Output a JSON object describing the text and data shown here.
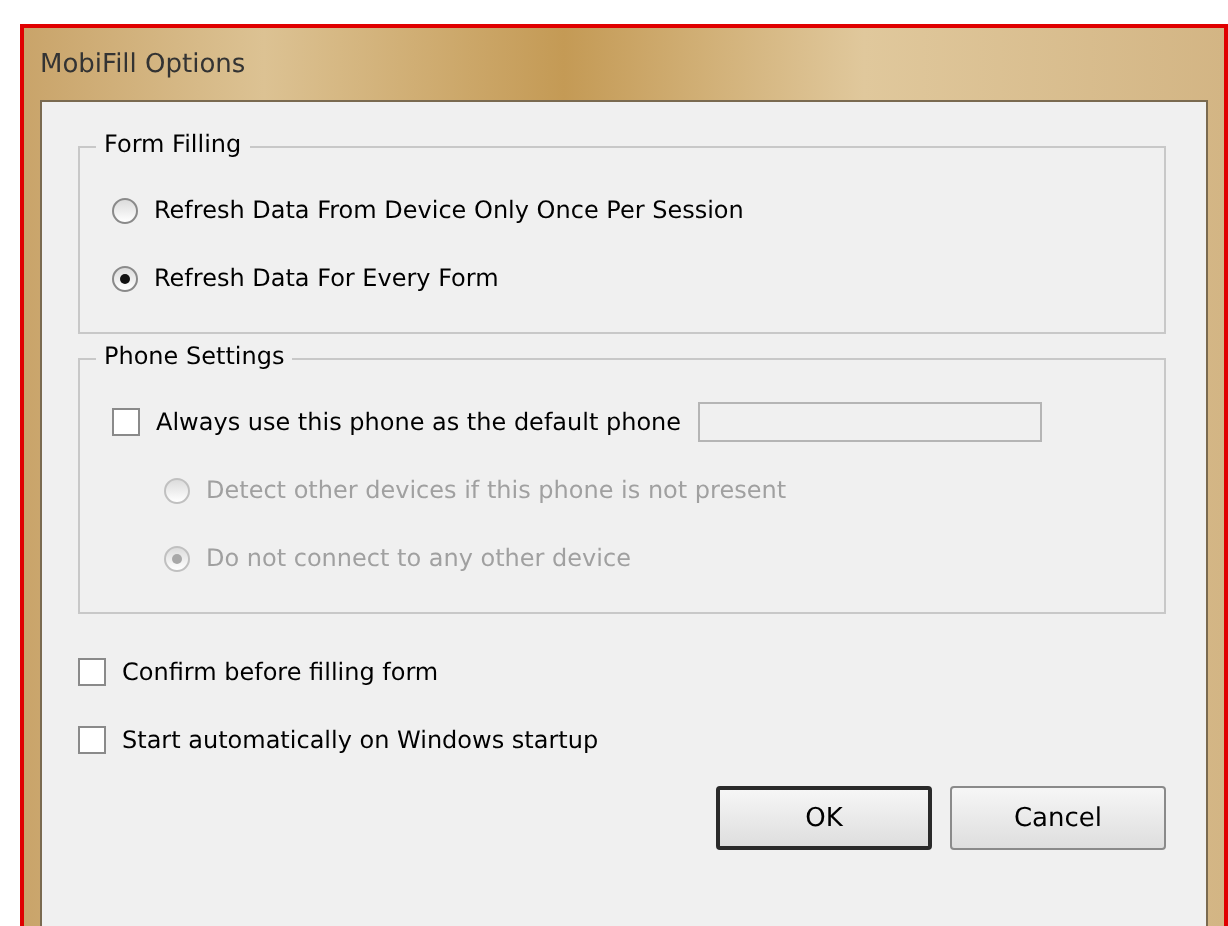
{
  "window": {
    "title": "MobiFill Options"
  },
  "form_filling": {
    "title": "Form Filling",
    "options": [
      {
        "label": "Refresh Data From Device Only Once Per Session",
        "selected": false
      },
      {
        "label": "Refresh Data For Every Form",
        "selected": true
      }
    ]
  },
  "phone_settings": {
    "title": "Phone Settings",
    "default_phone": {
      "label": "Always use this phone as the default phone",
      "checked": false
    },
    "phone_field": {
      "disabled": true
    },
    "options": [
      {
        "label": "Detect other devices if this phone is not present",
        "selected": false,
        "disabled": true
      },
      {
        "label": "Do not connect to any other device",
        "selected": true,
        "disabled": true
      }
    ]
  },
  "checkboxes": [
    {
      "label": "Confirm before filling form",
      "checked": false
    },
    {
      "label": "Start automatically on Windows startup",
      "checked": false
    }
  ],
  "buttons": [
    {
      "label": "OK",
      "default": true
    },
    {
      "label": "Cancel",
      "default": false
    }
  ]
}
